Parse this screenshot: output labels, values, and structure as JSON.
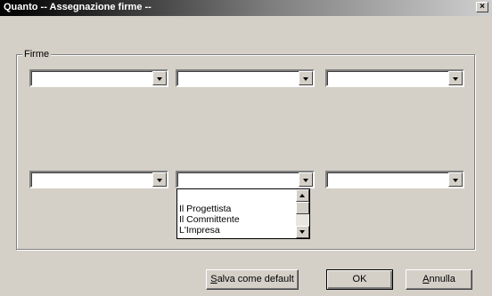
{
  "window": {
    "title": "Quanto  -- Assegnazione firme --",
    "close_glyph": "×"
  },
  "group": {
    "label": "Firme"
  },
  "dropdown_options": [
    "Il Progettista",
    "Il Committente",
    "L'Impresa"
  ],
  "buttons": {
    "save_default": {
      "label_mnemonic": "S",
      "label_rest": "alva come default"
    },
    "ok": {
      "label": "OK"
    },
    "cancel": {
      "label_mnemonic": "A",
      "label_rest": "nnulla"
    }
  }
}
